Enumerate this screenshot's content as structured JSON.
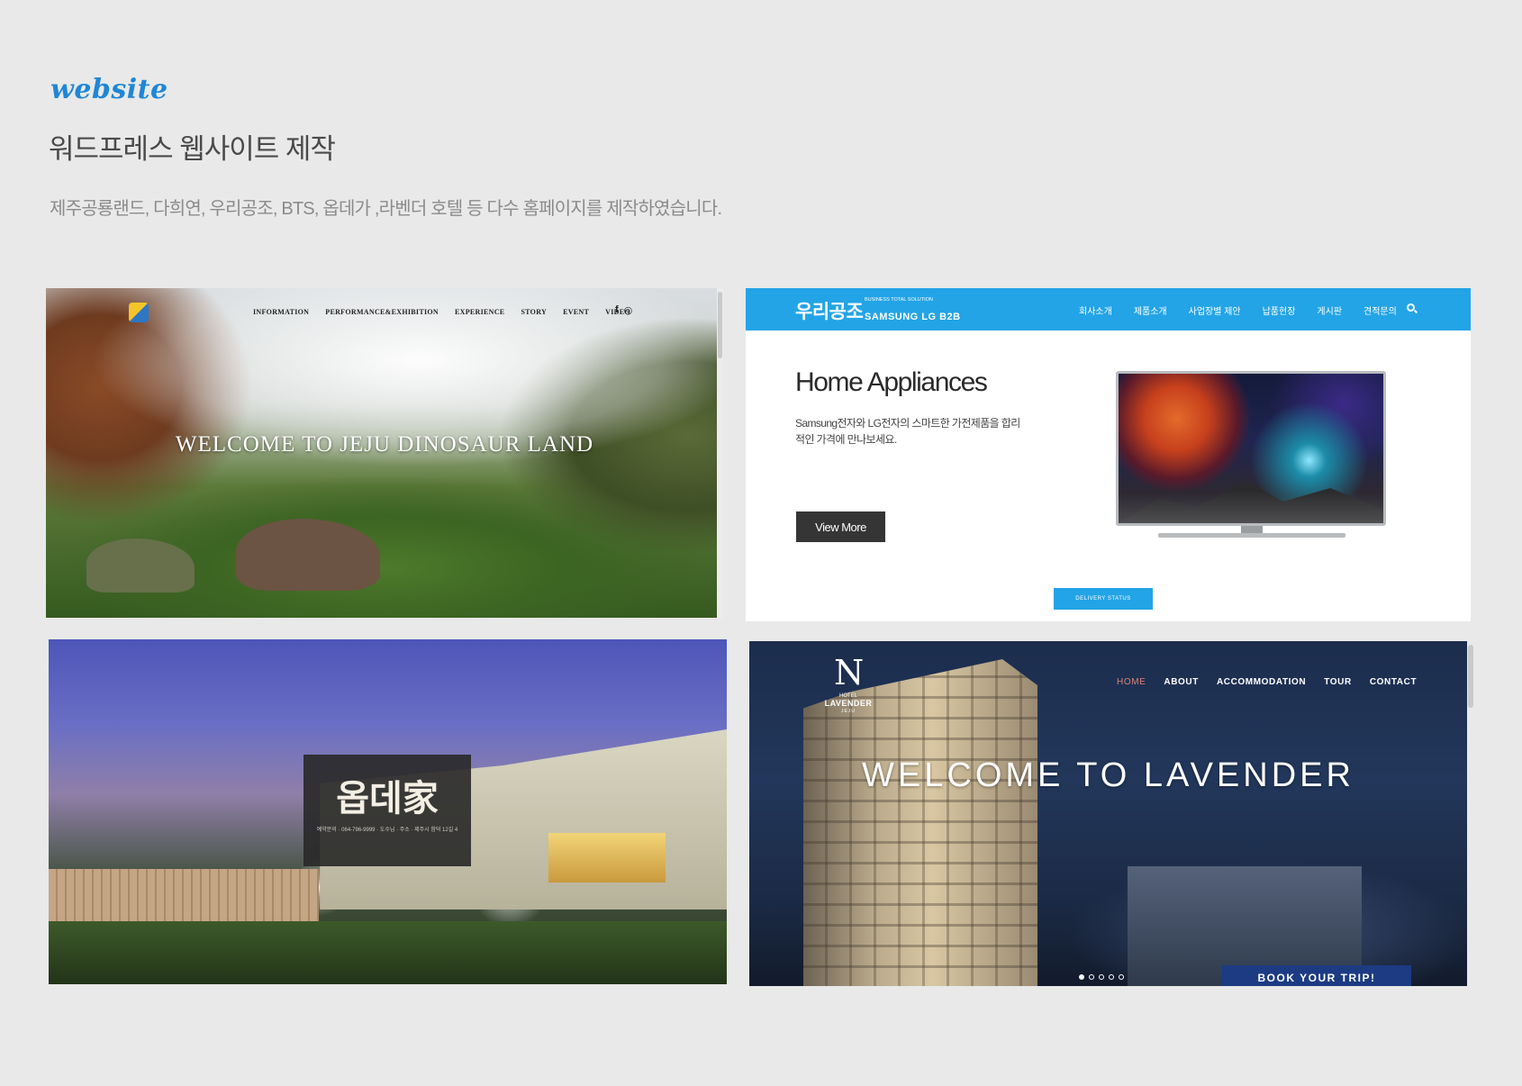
{
  "header": {
    "label": "website",
    "title": "워드프레스 웹사이트 제작",
    "description": "제주공룡랜드, 다희연, 우리공조, BTS, 옵데가 ,라벤더 호텔 등 다수 홈페이지를 제작하였습니다."
  },
  "colors": {
    "accent": "#1f86d6",
    "woorigongjo_blue": "#23a4e6",
    "page_background": "#e8e9e8"
  },
  "sites": {
    "jeju": {
      "nav": [
        "INFORMATION",
        "PERFORMANCE&EXHIBITION",
        "EXPERIENCE",
        "STORY",
        "EVENT",
        "VIDEO"
      ],
      "social": {
        "facebook": "f",
        "instagram": "◎"
      },
      "hero": "WELCOME TO JEJU DINOSAUR LAND"
    },
    "woorigongjo": {
      "brand": "우리공조",
      "brand_sub": "BUSINESS TOTAL SOLUTION",
      "brand_sub2": "SAMSUNG LG B2B",
      "nav": [
        "회사소개",
        "제품소개",
        "사업장별 제안",
        "납품현장",
        "게시판",
        "견적문의"
      ],
      "heading": "Home Appliances",
      "description": "Samsung전자와 LG전자의 스마트한 가전제품을 합리적인 가격에 만나보세요.",
      "view_more": "View More",
      "delivery_status": "DELIVERY STATUS"
    },
    "obdega": {
      "sign_title": "옵데家",
      "sign_info": "예약문의 · 064-796-9999 · 도수님 · 주소 · 제주시 함덕 12길 4"
    },
    "lavender": {
      "logo_mark": "N",
      "logo_sub": "HOTEL",
      "logo_name": "LAVENDER",
      "logo_year": "JEJU",
      "nav": [
        "HOME",
        "ABOUT",
        "ACCOMMODATION",
        "TOUR",
        "CONTACT"
      ],
      "hero": "WELCOME TO LAVENDER",
      "book": "BOOK YOUR TRIP!"
    }
  }
}
